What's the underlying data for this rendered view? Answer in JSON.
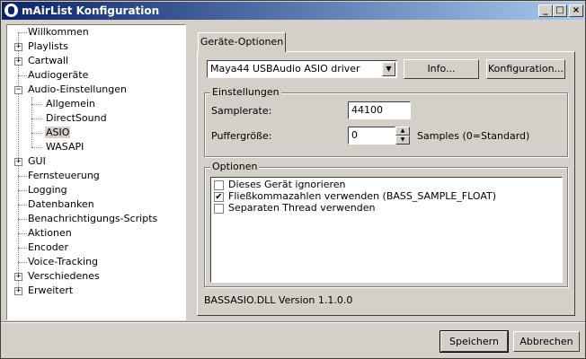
{
  "window": {
    "title": "mAirList Konfiguration"
  },
  "titlebar_buttons": {
    "minimize": "_",
    "maximize": "□",
    "close": "×"
  },
  "tree": {
    "items": [
      {
        "label": "Willkommen",
        "expander": ""
      },
      {
        "label": "Playlists",
        "expander": "+"
      },
      {
        "label": "Cartwall",
        "expander": "+"
      },
      {
        "label": "Audiogeräte",
        "expander": ""
      },
      {
        "label": "Audio-Einstellungen",
        "expander": "−"
      },
      {
        "label": "Allgemein",
        "expander": ""
      },
      {
        "label": "DirectSound",
        "expander": ""
      },
      {
        "label": "ASIO",
        "expander": ""
      },
      {
        "label": "WASAPI",
        "expander": ""
      },
      {
        "label": "GUI",
        "expander": "+"
      },
      {
        "label": "Fernsteuerung",
        "expander": ""
      },
      {
        "label": "Logging",
        "expander": ""
      },
      {
        "label": "Datenbanken",
        "expander": ""
      },
      {
        "label": "Benachrichtigungs-Scripts",
        "expander": ""
      },
      {
        "label": "Aktionen",
        "expander": ""
      },
      {
        "label": "Encoder",
        "expander": ""
      },
      {
        "label": "Voice-Tracking",
        "expander": ""
      },
      {
        "label": "Verschiedenes",
        "expander": "+"
      },
      {
        "label": "Erweitert",
        "expander": "+"
      }
    ]
  },
  "tab": {
    "label": "Geräte-Optionen"
  },
  "driver": {
    "selected": "Maya44 USBAudio ASIO driver",
    "arrow": "▼"
  },
  "buttons": {
    "info": "Info...",
    "config": "Konfiguration...",
    "save": "Speichern",
    "cancel": "Abbrechen"
  },
  "settings": {
    "title": "Einstellungen",
    "samplerate_label": "Samplerate:",
    "samplerate_value": "44100",
    "buffer_label": "Puffergröße:",
    "buffer_value": "0",
    "buffer_hint": "Samples (0=Standard)",
    "spin_up": "▲",
    "spin_down": "▼"
  },
  "options": {
    "title": "Optionen",
    "items": [
      {
        "label": "Dieses Gerät ignorieren",
        "mark": ""
      },
      {
        "label": "Fließkommazahlen verwenden (BASS_SAMPLE_FLOAT)",
        "mark": "✔"
      },
      {
        "label": "Separaten Thread verwenden",
        "mark": ""
      }
    ]
  },
  "version": "BASSASIO.DLL Version 1.1.0.0"
}
